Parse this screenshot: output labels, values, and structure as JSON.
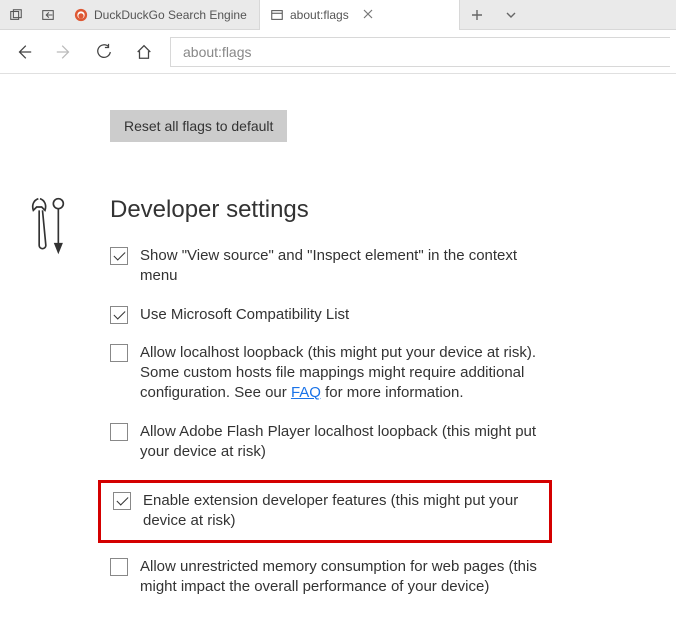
{
  "titlebar": {
    "tab1": {
      "label": "DuckDuckGo Search Engine"
    },
    "tab2": {
      "label": "about:flags"
    }
  },
  "toolbar": {
    "address": "about:flags"
  },
  "page": {
    "reset_label": "Reset all flags to default",
    "section_title": "Developer settings",
    "options": {
      "view_source": {
        "checked": true,
        "label": "Show \"View source\" and \"Inspect element\" in the context menu"
      },
      "compat_list": {
        "checked": true,
        "label": "Use Microsoft Compatibility List"
      },
      "localhost_loopback": {
        "checked": false,
        "label_pre": "Allow localhost loopback (this might put your device at risk). Some custom hosts file mappings might require additional configuration. See our ",
        "faq_link": "FAQ",
        "label_post": " for more information."
      },
      "flash_loopback": {
        "checked": false,
        "label": "Allow Adobe Flash Player localhost loopback (this might put your device at risk)"
      },
      "ext_dev": {
        "checked": true,
        "label": "Enable extension developer features (this might put your device at risk)"
      },
      "unrestricted_mem": {
        "checked": false,
        "label": "Allow unrestricted memory consumption for web pages (this might impact the overall performance of your device)"
      }
    }
  }
}
